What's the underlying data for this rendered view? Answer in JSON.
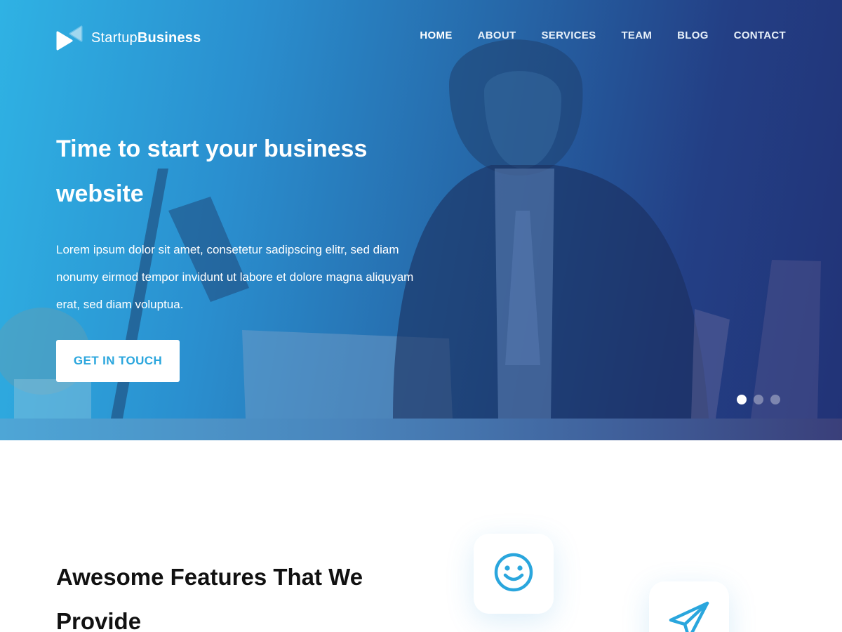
{
  "brand": {
    "name_light": "Startup",
    "name_bold": "Business"
  },
  "nav": {
    "items": [
      {
        "label": "HOME",
        "active": true
      },
      {
        "label": "ABOUT",
        "active": false
      },
      {
        "label": "SERVICES",
        "active": false
      },
      {
        "label": "TEAM",
        "active": false
      },
      {
        "label": "BLOG",
        "active": false
      },
      {
        "label": "CONTACT",
        "active": false
      }
    ]
  },
  "hero": {
    "title": "Time to start your business website",
    "text": "Lorem ipsum dolor sit amet, consetetur sadipscing elitr, sed diam nonumy eirmod tempor invidunt ut labore et dolore magna aliquyam erat, sed diam voluptua.",
    "cta_label": "GET IN TOUCH",
    "slides": {
      "count": 3,
      "active_index": 0
    }
  },
  "features": {
    "title": "Awesome Features That We Provide",
    "icons": [
      "smile-icon",
      "paper-plane-icon"
    ]
  },
  "colors": {
    "accent": "#2aa6dd",
    "hero_gradient_start": "#2fb2e4",
    "hero_gradient_end": "#223377",
    "heading_text": "#111111"
  }
}
